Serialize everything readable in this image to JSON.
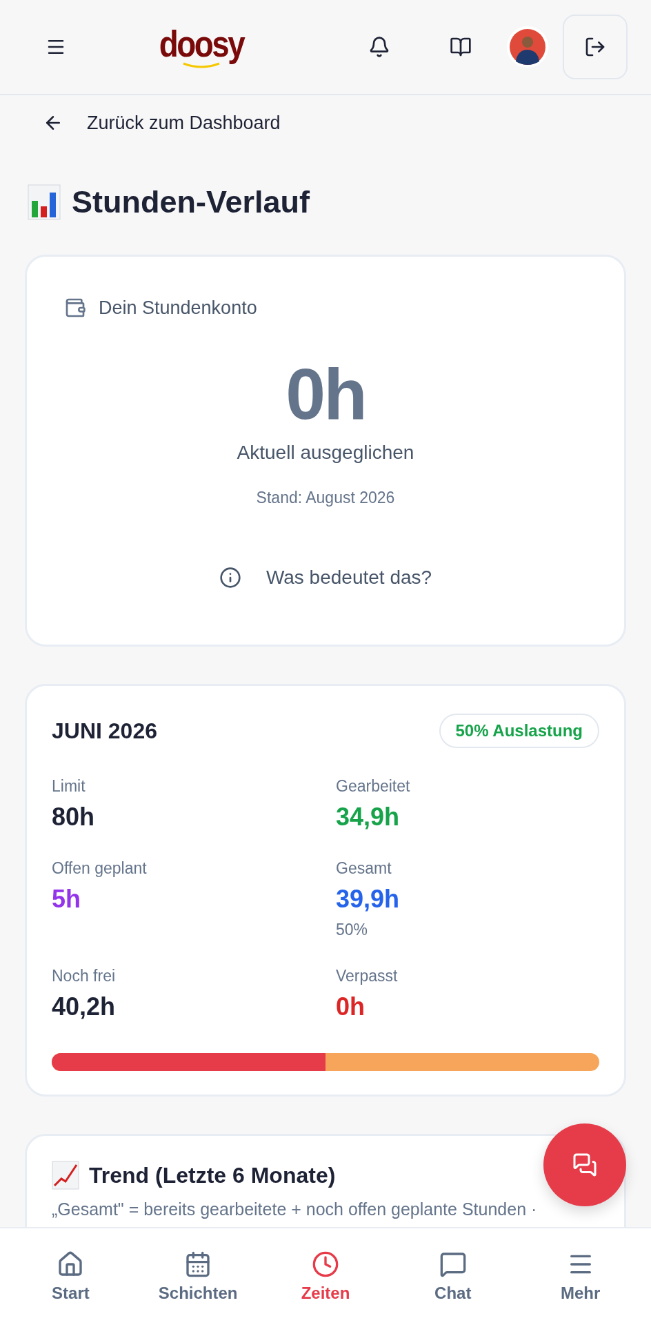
{
  "header": {
    "logo": "doosy"
  },
  "back_link": {
    "label": "Zurück zum Dashboard"
  },
  "page_title": "Stunden-Verlauf",
  "balance_card": {
    "heading": "Dein Stundenkonto",
    "value": "0h",
    "status": "Aktuell ausgeglichen",
    "as_of": "Stand: August 2026",
    "help_link": "Was bedeutet das?"
  },
  "month_card": {
    "title": "JUNI 2026",
    "badge": "50% Auslastung",
    "stats": [
      {
        "label": "Limit",
        "value": "80h",
        "color": "#1e2235"
      },
      {
        "label": "Gearbeitet",
        "value": "34,9h",
        "color": "#16a34a"
      },
      {
        "label": "Offen geplant",
        "value": "5h",
        "color": "#9333ea"
      },
      {
        "label": "Gesamt",
        "value": "39,9h",
        "color": "#2563eb",
        "note": "50%"
      },
      {
        "label": "Noch frei",
        "value": "40,2h",
        "color": "#1e2235"
      },
      {
        "label": "Verpasst",
        "value": "0h",
        "color": "#dc2626"
      }
    ],
    "progress": {
      "level": 0.5
    }
  },
  "trend_card": {
    "title": "Trend (Letzte 6 Monate)",
    "note": "„Gesamt\" = bereits gearbeitete + noch offen geplante Stunden ·"
  },
  "bottom_nav": [
    {
      "label": "Start",
      "kind": "home",
      "selected": false
    },
    {
      "label": "Schichten",
      "kind": "calendar",
      "selected": false
    },
    {
      "label": "Zeiten",
      "kind": "clock",
      "selected": true
    },
    {
      "label": "Chat",
      "kind": "chat",
      "selected": false
    },
    {
      "label": "Mehr",
      "kind": "menu",
      "selected": false
    }
  ]
}
